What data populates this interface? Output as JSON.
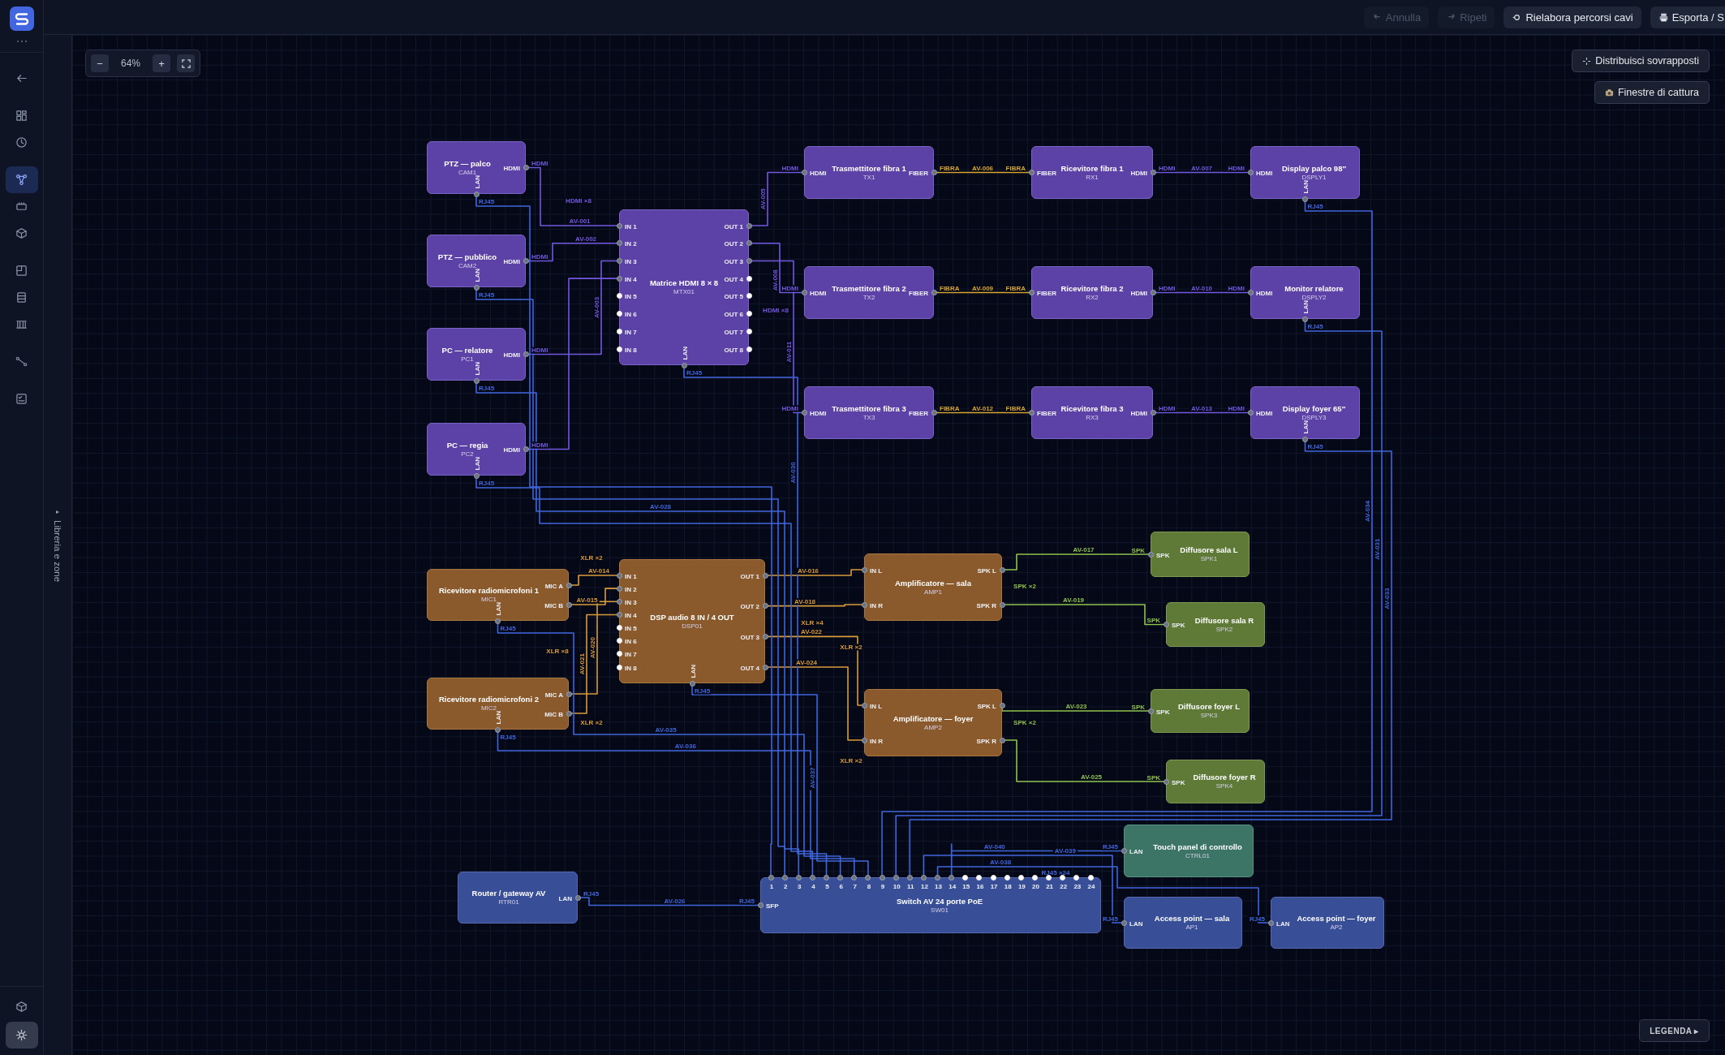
{
  "rail": {
    "items": [
      {
        "selected": false
      },
      {
        "selected": false
      },
      {
        "selected": false
      },
      {
        "selected": true
      },
      {
        "selected": false
      },
      {
        "selected": false
      },
      {
        "selected": false
      },
      {
        "selected": false
      },
      {
        "selected": false
      },
      {
        "selected": false
      },
      {
        "selected": false
      },
      {
        "selected": false
      }
    ]
  },
  "library_panel": {
    "toggle": "▸",
    "title": "Libreria e zone"
  },
  "toolbar": {
    "buttons": [
      {
        "label": "Annulla",
        "disabled": true
      },
      {
        "label": "Ripeti",
        "disabled": true
      },
      {
        "label": "Rielabora percorsi cavi",
        "disabled": false
      },
      {
        "label": "Esporta / S",
        "disabled": false
      }
    ]
  },
  "zoom": {
    "minus": "−",
    "value": "64%",
    "plus": "+"
  },
  "canvas_actions": [
    {
      "label": "Distribuisci sovrapposti"
    },
    {
      "label": "Finestre di cattura"
    }
  ],
  "nodes": [
    {
      "kind": "video",
      "title": "PTZ — palco",
      "code": "CAM1",
      "right_ports": [
        {
          "label": "HDMI",
          "connected": true
        }
      ],
      "bottom_ports": [
        {
          "label": "LAN",
          "connected": true
        }
      ]
    },
    {
      "kind": "video",
      "title": "PTZ — pubblico",
      "code": "CAM2",
      "right_ports": [
        {
          "label": "HDMI",
          "connected": true
        }
      ],
      "bottom_ports": [
        {
          "label": "LAN",
          "connected": true
        }
      ]
    },
    {
      "kind": "video",
      "title": "PC — relatore",
      "code": "PC1",
      "right_ports": [
        {
          "label": "HDMI",
          "connected": true
        }
      ],
      "bottom_ports": [
        {
          "label": "LAN",
          "connected": true
        }
      ]
    },
    {
      "kind": "video",
      "title": "PC — regia",
      "code": "PC2",
      "right_ports": [
        {
          "label": "HDMI",
          "connected": true
        }
      ],
      "bottom_ports": [
        {
          "label": "LAN",
          "connected": true
        }
      ]
    },
    {
      "kind": "video",
      "title": "Matrice HDMI 8 × 8",
      "code": "MTX01",
      "left_ports": [
        {
          "label": "IN 1",
          "connected": true
        },
        {
          "label": "IN 2",
          "connected": true
        },
        {
          "label": "IN 3",
          "connected": true
        },
        {
          "label": "IN 4",
          "connected": true
        },
        {
          "label": "IN 5",
          "connected": false
        },
        {
          "label": "IN 6",
          "connected": false
        },
        {
          "label": "IN 7",
          "connected": false
        },
        {
          "label": "IN 8",
          "connected": false
        }
      ],
      "right_ports": [
        {
          "label": "OUT 1",
          "connected": true
        },
        {
          "label": "OUT 2",
          "connected": true
        },
        {
          "label": "OUT 3",
          "connected": true
        },
        {
          "label": "OUT 4",
          "connected": false
        },
        {
          "label": "OUT 5",
          "connected": false
        },
        {
          "label": "OUT 6",
          "connected": false
        },
        {
          "label": "OUT 7",
          "connected": false
        },
        {
          "label": "OUT 8",
          "connected": false
        }
      ],
      "bottom_ports": [
        {
          "label": "LAN",
          "connected": true
        }
      ]
    },
    {
      "kind": "video",
      "title": "Trasmettitore fibra 1",
      "code": "TX1",
      "left_ports": [
        {
          "label": "HDMI",
          "connected": true
        }
      ],
      "right_ports": [
        {
          "label": "FIBER",
          "connected": true
        }
      ]
    },
    {
      "kind": "video",
      "title": "Ricevitore fibra 1",
      "code": "RX1",
      "left_ports": [
        {
          "label": "FIBER",
          "connected": true
        }
      ],
      "right_ports": [
        {
          "label": "HDMI",
          "connected": true
        }
      ]
    },
    {
      "kind": "video",
      "title": "Display palco 98″",
      "code": "DSPLY1",
      "left_ports": [
        {
          "label": "HDMI",
          "connected": true
        }
      ],
      "bottom_ports": [
        {
          "label": "LAN",
          "connected": true
        }
      ]
    },
    {
      "kind": "video",
      "title": "Trasmettitore fibra 2",
      "code": "TX2",
      "left_ports": [
        {
          "label": "HDMI",
          "connected": true
        }
      ],
      "right_ports": [
        {
          "label": "FIBER",
          "connected": true
        }
      ]
    },
    {
      "kind": "video",
      "title": "Ricevitore fibra 2",
      "code": "RX2",
      "left_ports": [
        {
          "label": "FIBER",
          "connected": true
        }
      ],
      "right_ports": [
        {
          "label": "HDMI",
          "connected": true
        }
      ]
    },
    {
      "kind": "video",
      "title": "Monitor relatore",
      "code": "DSPLY2",
      "left_ports": [
        {
          "label": "HDMI",
          "connected": true
        }
      ],
      "bottom_ports": [
        {
          "label": "LAN",
          "connected": true
        }
      ]
    },
    {
      "kind": "video",
      "title": "Trasmettitore fibra 3",
      "code": "TX3",
      "left_ports": [
        {
          "label": "HDMI",
          "connected": true
        }
      ],
      "right_ports": [
        {
          "label": "FIBER",
          "connected": true
        }
      ]
    },
    {
      "kind": "video",
      "title": "Ricevitore fibra 3",
      "code": "RX3",
      "left_ports": [
        {
          "label": "FIBER",
          "connected": true
        }
      ],
      "right_ports": [
        {
          "label": "HDMI",
          "connected": true
        }
      ]
    },
    {
      "kind": "video",
      "title": "Display foyer 65″",
      "code": "DSPLY3",
      "left_ports": [
        {
          "label": "HDMI",
          "connected": true
        }
      ],
      "bottom_ports": [
        {
          "label": "LAN",
          "connected": true
        }
      ]
    },
    {
      "kind": "audio",
      "title": "Ricevitore radiomicrofoni 1",
      "code": "MIC1",
      "right_ports": [
        {
          "label": "MIC A",
          "connected": true
        },
        {
          "label": "MIC B",
          "connected": true
        }
      ],
      "bottom_ports": [
        {
          "label": "LAN",
          "connected": true
        }
      ]
    },
    {
      "kind": "audio",
      "title": "Ricevitore radiomicrofoni 2",
      "code": "MIC2",
      "right_ports": [
        {
          "label": "MIC A",
          "connected": true
        },
        {
          "label": "MIC B",
          "connected": true
        }
      ],
      "bottom_ports": [
        {
          "label": "LAN",
          "connected": true
        }
      ]
    },
    {
      "kind": "audio",
      "title": "DSP audio 8 IN / 4 OUT",
      "code": "DSP01",
      "left_ports": [
        {
          "label": "IN 1",
          "connected": true
        },
        {
          "label": "IN 2",
          "connected": true
        },
        {
          "label": "IN 3",
          "connected": true
        },
        {
          "label": "IN 4",
          "connected": true
        },
        {
          "label": "IN 5",
          "connected": false
        },
        {
          "label": "IN 6",
          "connected": false
        },
        {
          "label": "IN 7",
          "connected": false
        },
        {
          "label": "IN 8",
          "connected": false
        }
      ],
      "right_ports": [
        {
          "label": "OUT 1",
          "connected": true
        },
        {
          "label": "OUT 2",
          "connected": true
        },
        {
          "label": "OUT 3",
          "connected": true
        },
        {
          "label": "OUT 4",
          "connected": true
        }
      ],
      "bottom_ports": [
        {
          "label": "LAN",
          "connected": true
        }
      ]
    },
    {
      "kind": "audio",
      "title": "Amplificatore — sala",
      "code": "AMP1",
      "left_ports": [
        {
          "label": "IN L",
          "connected": true
        },
        {
          "label": "IN R",
          "connected": true
        }
      ],
      "right_ports": [
        {
          "label": "SPK L",
          "connected": true
        },
        {
          "label": "SPK R",
          "connected": true
        }
      ]
    },
    {
      "kind": "audio",
      "title": "Amplificatore — foyer",
      "code": "AMP2",
      "left_ports": [
        {
          "label": "IN L",
          "connected": true
        },
        {
          "label": "IN R",
          "connected": true
        }
      ],
      "right_ports": [
        {
          "label": "SPK L",
          "connected": true
        },
        {
          "label": "SPK R",
          "connected": true
        }
      ]
    },
    {
      "kind": "speaker",
      "title": "Diffusore sala L",
      "code": "SPK1",
      "left_ports": [
        {
          "label": "SPK",
          "connected": true
        }
      ]
    },
    {
      "kind": "speaker",
      "title": "Diffusore sala R",
      "code": "SPK2",
      "left_ports": [
        {
          "label": "SPK",
          "connected": true
        }
      ]
    },
    {
      "kind": "speaker",
      "title": "Diffusore foyer L",
      "code": "SPK3",
      "left_ports": [
        {
          "label": "SPK",
          "connected": true
        }
      ]
    },
    {
      "kind": "speaker",
      "title": "Diffusore foyer R",
      "code": "SPK4",
      "left_ports": [
        {
          "label": "SPK",
          "connected": true
        }
      ]
    },
    {
      "kind": "control",
      "title": "Touch panel di controllo",
      "code": "CTRL01",
      "left_ports": [
        {
          "label": "LAN",
          "connected": true
        }
      ]
    },
    {
      "kind": "network",
      "title": "Router / gateway AV",
      "code": "RTR01",
      "right_ports": [
        {
          "label": "LAN",
          "connected": true
        }
      ]
    },
    {
      "kind": "network",
      "title": "Switch AV 24 porte PoE",
      "code": "SW01",
      "left_ports": [
        {
          "label": "SFP",
          "connected": true
        }
      ],
      "top_ports": [
        {
          "label": "1",
          "connected": true
        },
        {
          "label": "2",
          "connected": true
        },
        {
          "label": "3",
          "connected": true
        },
        {
          "label": "4",
          "connected": true
        },
        {
          "label": "5",
          "connected": true
        },
        {
          "label": "6",
          "connected": true
        },
        {
          "label": "7",
          "connected": true
        },
        {
          "label": "8",
          "connected": true
        },
        {
          "label": "9",
          "connected": true
        },
        {
          "label": "10",
          "connected": true
        },
        {
          "label": "11",
          "connected": true
        },
        {
          "label": "12",
          "connected": true
        },
        {
          "label": "13",
          "connected": true
        },
        {
          "label": "14",
          "connected": true
        },
        {
          "label": "15",
          "connected": false
        },
        {
          "label": "16",
          "connected": false
        },
        {
          "label": "17",
          "connected": false
        },
        {
          "label": "18",
          "connected": false
        },
        {
          "label": "19",
          "connected": false
        },
        {
          "label": "20",
          "connected": false
        },
        {
          "label": "21",
          "connected": false
        },
        {
          "label": "22",
          "connected": false
        },
        {
          "label": "23",
          "connected": false
        },
        {
          "label": "24",
          "connected": false
        }
      ]
    },
    {
      "kind": "network",
      "title": "Access point — sala",
      "code": "AP1",
      "left_ports": [
        {
          "label": "LAN",
          "connected": true
        }
      ]
    },
    {
      "kind": "network",
      "title": "Access point — foyer",
      "code": "AP2",
      "left_ports": [
        {
          "label": "LAN",
          "connected": true
        }
      ]
    }
  ],
  "cables": [
    {
      "kind": "video",
      "label": "AV-001",
      "from_tag": "HDMI"
    },
    {
      "kind": "video",
      "label": "AV-002",
      "from_tag": "HDMI"
    },
    {
      "kind": "video",
      "label": "AV-003",
      "from_tag": "HDMI"
    },
    {
      "kind": "video",
      "from_tag": "HDMI"
    },
    {
      "kind": "video",
      "label": "AV-005",
      "to_tag": "HDMI"
    },
    {
      "kind": "fiber",
      "label": "AV-006",
      "from_tag": "FIBRA",
      "to_tag": "FIBRA"
    },
    {
      "kind": "video",
      "label": "AV-007",
      "from_tag": "HDMI",
      "to_tag": "HDMI"
    },
    {
      "kind": "video",
      "label": "AV-008",
      "to_tag": "HDMI"
    },
    {
      "kind": "fiber",
      "label": "AV-009",
      "from_tag": "FIBRA",
      "to_tag": "FIBRA"
    },
    {
      "kind": "video",
      "label": "AV-010",
      "from_tag": "HDMI",
      "to_tag": "HDMI"
    },
    {
      "kind": "video",
      "label": "AV-011",
      "to_tag": "HDMI"
    },
    {
      "kind": "fiber",
      "label": "AV-012",
      "from_tag": "FIBRA",
      "to_tag": "FIBRA"
    },
    {
      "kind": "video",
      "label": "AV-013",
      "from_tag": "HDMI",
      "to_tag": "HDMI"
    },
    {
      "kind": "audio",
      "label": "AV-014"
    },
    {
      "kind": "audio",
      "label": "AV-015"
    },
    {
      "kind": "audio",
      "label": "AV-020"
    },
    {
      "kind": "audio",
      "label": "AV-021"
    },
    {
      "kind": "audio",
      "label": "AV-016"
    },
    {
      "kind": "audio",
      "label": "AV-018"
    },
    {
      "kind": "audio",
      "label": "AV-022"
    },
    {
      "kind": "audio",
      "label": "AV-024"
    },
    {
      "kind": "speaker",
      "label": "AV-017",
      "to_tag": "SPK"
    },
    {
      "kind": "speaker",
      "label": "AV-019",
      "to_tag": "SPK"
    },
    {
      "kind": "speaker",
      "label": "AV-023",
      "to_tag": "SPK"
    },
    {
      "kind": "speaker",
      "label": "AV-025",
      "to_tag": "SPK"
    },
    {
      "kind": "network",
      "from_tag": "RJ45"
    },
    {
      "kind": "network",
      "from_tag": "RJ45"
    },
    {
      "kind": "network",
      "label": "AV-028",
      "from_tag": "RJ45"
    },
    {
      "kind": "network",
      "from_tag": "RJ45"
    },
    {
      "kind": "network",
      "label": "AV-030",
      "from_tag": "RJ45"
    },
    {
      "kind": "network",
      "label": "AV-035",
      "from_tag": "RJ45"
    },
    {
      "kind": "network",
      "label": "AV-036",
      "from_tag": "RJ45"
    },
    {
      "kind": "network",
      "label": "AV-037",
      "from_tag": "RJ45"
    },
    {
      "kind": "network",
      "label": "AV-034",
      "from_tag": "RJ45"
    },
    {
      "kind": "network",
      "label": "AV-031",
      "from_tag": "RJ45"
    },
    {
      "kind": "network",
      "label": "AV-033",
      "from_tag": "RJ45"
    },
    {
      "kind": "network",
      "label": "AV-026",
      "from_tag": "RJ45",
      "to_tag": "RJ45"
    },
    {
      "kind": "network",
      "label": "AV-040",
      "to_tag": "RJ45"
    },
    {
      "kind": "network",
      "label": "AV-039",
      "to_tag": "RJ45"
    },
    {
      "kind": "network",
      "label": "AV-038",
      "to_tag": "RJ45"
    }
  ],
  "bundle_labels": [
    {
      "text": "HDMI ×8",
      "kind": "video"
    },
    {
      "text": "HDMI ×8",
      "kind": "video"
    },
    {
      "text": "XLR ×2",
      "kind": "audio"
    },
    {
      "text": "XLR ×8",
      "kind": "audio"
    },
    {
      "text": "XLR ×2",
      "kind": "audio"
    },
    {
      "text": "XLR ×4",
      "kind": "audio"
    },
    {
      "text": "XLR ×2",
      "kind": "audio"
    },
    {
      "text": "XLR ×2",
      "kind": "audio"
    },
    {
      "text": "SPK ×2",
      "kind": "speaker"
    },
    {
      "text": "SPK ×2",
      "kind": "speaker"
    },
    {
      "text": "RJ45 ×24",
      "kind": "network"
    }
  ],
  "legend_button": "LEGENDA ▸"
}
